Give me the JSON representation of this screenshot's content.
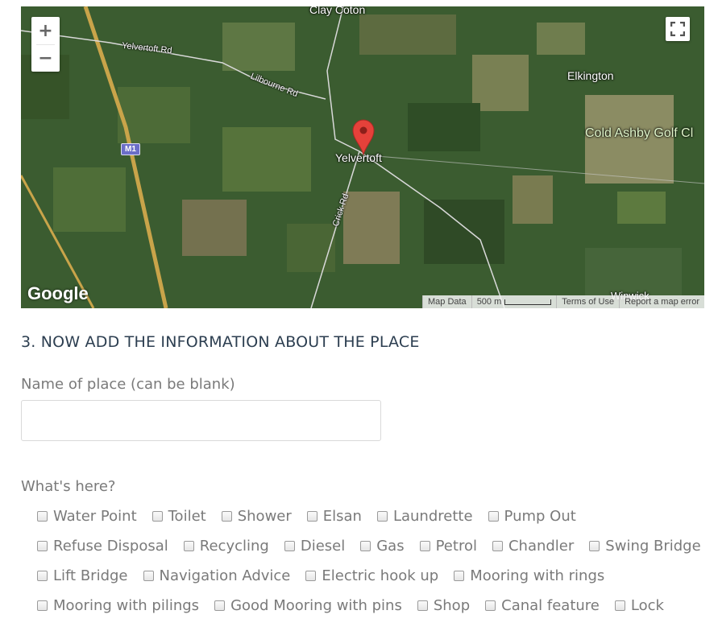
{
  "map": {
    "labels": {
      "clay_coton": "Clay Coton",
      "elkington": "Elkington",
      "cold_ashby": "Cold Ashby Golf Cl",
      "yelvertoft": "Yelvertoft",
      "winwick": "Winwick"
    },
    "roads": {
      "yelvertoft_rd": "Yelvertoft Rd",
      "lilbourne_rd": "Lilbourne Rd",
      "crick_rd": "Crick Rd",
      "motorway": "M1"
    },
    "controls": {
      "zoom_in": "+",
      "zoom_out": "−"
    },
    "logo": "Google",
    "attribution": {
      "map_data": "Map Data",
      "scale": "500 m",
      "terms": "Terms of Use",
      "report": "Report a map error"
    },
    "colors": {
      "pin": "#e5413a",
      "terrain": "#3a5a2e"
    }
  },
  "form": {
    "section_title": "3. NOW ADD THE INFORMATION ABOUT THE PLACE",
    "name_label": "Name of place (can be blank)",
    "name_value": "",
    "whats_here_label": "What's here?",
    "amenities": [
      [
        "Water Point",
        "Toilet",
        "Shower",
        "Elsan",
        "Laundrette",
        "Pump Out"
      ],
      [
        "Refuse Disposal",
        "Recycling",
        "Diesel",
        "Gas",
        "Petrol",
        "Chandler",
        "Swing Bridge"
      ],
      [
        "Lift Bridge",
        "Navigation Advice",
        "Electric hook up",
        "Mooring with rings"
      ],
      [
        "Mooring with pilings",
        "Good Mooring with pins",
        "Shop",
        "Canal feature",
        "Lock"
      ]
    ]
  }
}
